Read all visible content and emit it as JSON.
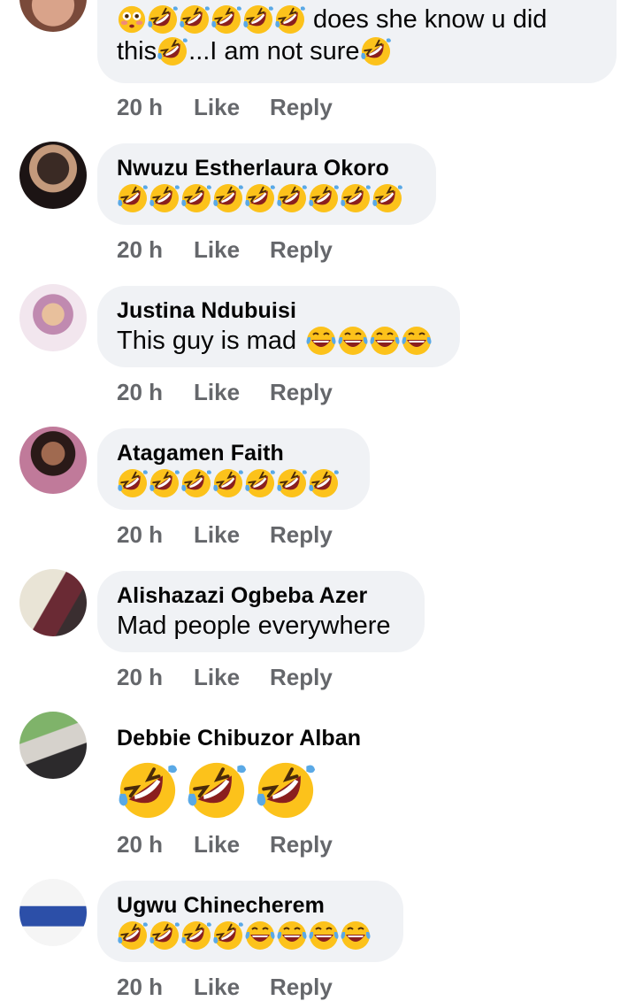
{
  "colors": {
    "bubble_bg": "#f0f2f5",
    "meta_text": "#65676b",
    "text": "#050505",
    "emoji_face": "#fcc21b",
    "emoji_mouth": "#8a1f1f",
    "emoji_tear": "#5aa9e6"
  },
  "comments": [
    {
      "author": "",
      "text_parts": [
        "does she know u did",
        "this",
        "...I am not sure"
      ],
      "emoji_lead": [
        "flushed-face-emoji",
        "rofl-emoji",
        "rofl-emoji",
        "rofl-emoji",
        "rofl-emoji",
        "rofl-emoji"
      ],
      "time": "20 h",
      "like": "Like",
      "reply": "Reply"
    },
    {
      "author": "Nwuzu Estherlaura Okoro",
      "emoji": [
        "rofl-emoji",
        "rofl-emoji",
        "rofl-emoji",
        "rofl-emoji",
        "rofl-emoji",
        "rofl-emoji",
        "rofl-emoji",
        "rofl-emoji",
        "rofl-emoji"
      ],
      "time": "20 h",
      "like": "Like",
      "reply": "Reply"
    },
    {
      "author": "Justina Ndubuisi",
      "text": "This guy is mad",
      "emoji": [
        "joy-emoji",
        "joy-emoji",
        "joy-emoji",
        "joy-emoji"
      ],
      "time": "20 h",
      "like": "Like",
      "reply": "Reply"
    },
    {
      "author": "Atagamen Faith",
      "emoji": [
        "rofl-emoji",
        "rofl-emoji",
        "rofl-emoji",
        "rofl-emoji",
        "rofl-emoji",
        "rofl-emoji",
        "rofl-emoji"
      ],
      "time": "20 h",
      "like": "Like",
      "reply": "Reply"
    },
    {
      "author": "Alishazazi Ogbeba Azer",
      "text": "Mad people everywhere",
      "time": "20 h",
      "like": "Like",
      "reply": "Reply"
    },
    {
      "author": "Debbie Chibuzor Alban",
      "emoji": [
        "rofl-emoji-large",
        "rofl-emoji-large",
        "rofl-emoji-large"
      ],
      "time": "20 h",
      "like": "Like",
      "reply": "Reply"
    },
    {
      "author": "Ugwu Chinecherem",
      "emoji": [
        "rofl-emoji",
        "rofl-emoji",
        "rofl-emoji",
        "rofl-emoji",
        "joy-emoji",
        "joy-emoji",
        "joy-emoji",
        "joy-emoji"
      ],
      "time": "20 h",
      "like": "Like",
      "reply": "Reply"
    }
  ]
}
